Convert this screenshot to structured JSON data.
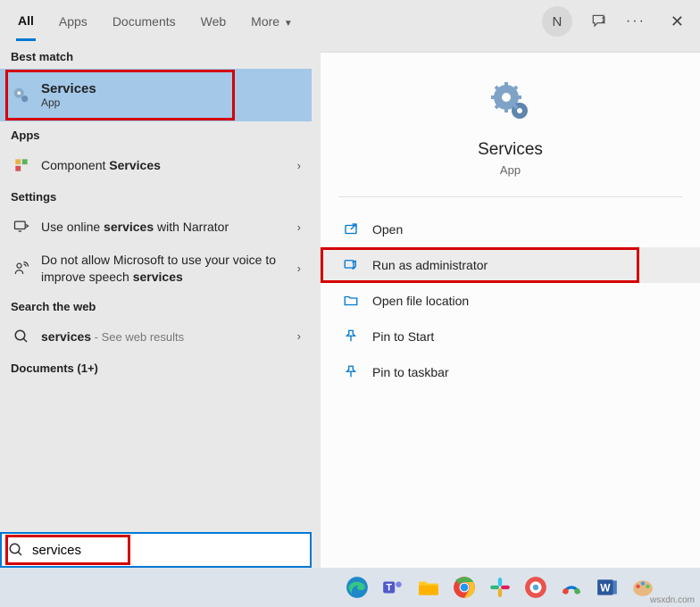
{
  "header": {
    "tabs": [
      "All",
      "Apps",
      "Documents",
      "Web",
      "More"
    ],
    "avatar_initial": "N"
  },
  "left": {
    "best_match_h": "Best match",
    "selected": {
      "title": "Services",
      "sub": "App"
    },
    "apps_h": "Apps",
    "component_pre": "Component ",
    "component_bold": "Services",
    "settings_h": "Settings",
    "setting1_pre": "Use online ",
    "setting1_bold": "services",
    "setting1_post": " with Narrator",
    "setting2_pre": "Do not allow Microsoft to use your voice to improve speech ",
    "setting2_bold": "services",
    "web_h": "Search the web",
    "web_bold": "services",
    "web_post": " - See web results",
    "docs_h": "Documents (1+)"
  },
  "right": {
    "title": "Services",
    "sub": "App",
    "actions": {
      "open": "Open",
      "run_admin": "Run as administrator",
      "open_loc": "Open file location",
      "pin_start": "Pin to Start",
      "pin_taskbar": "Pin to taskbar"
    }
  },
  "search": {
    "value": "services"
  },
  "watermark": "wsxdn.com"
}
